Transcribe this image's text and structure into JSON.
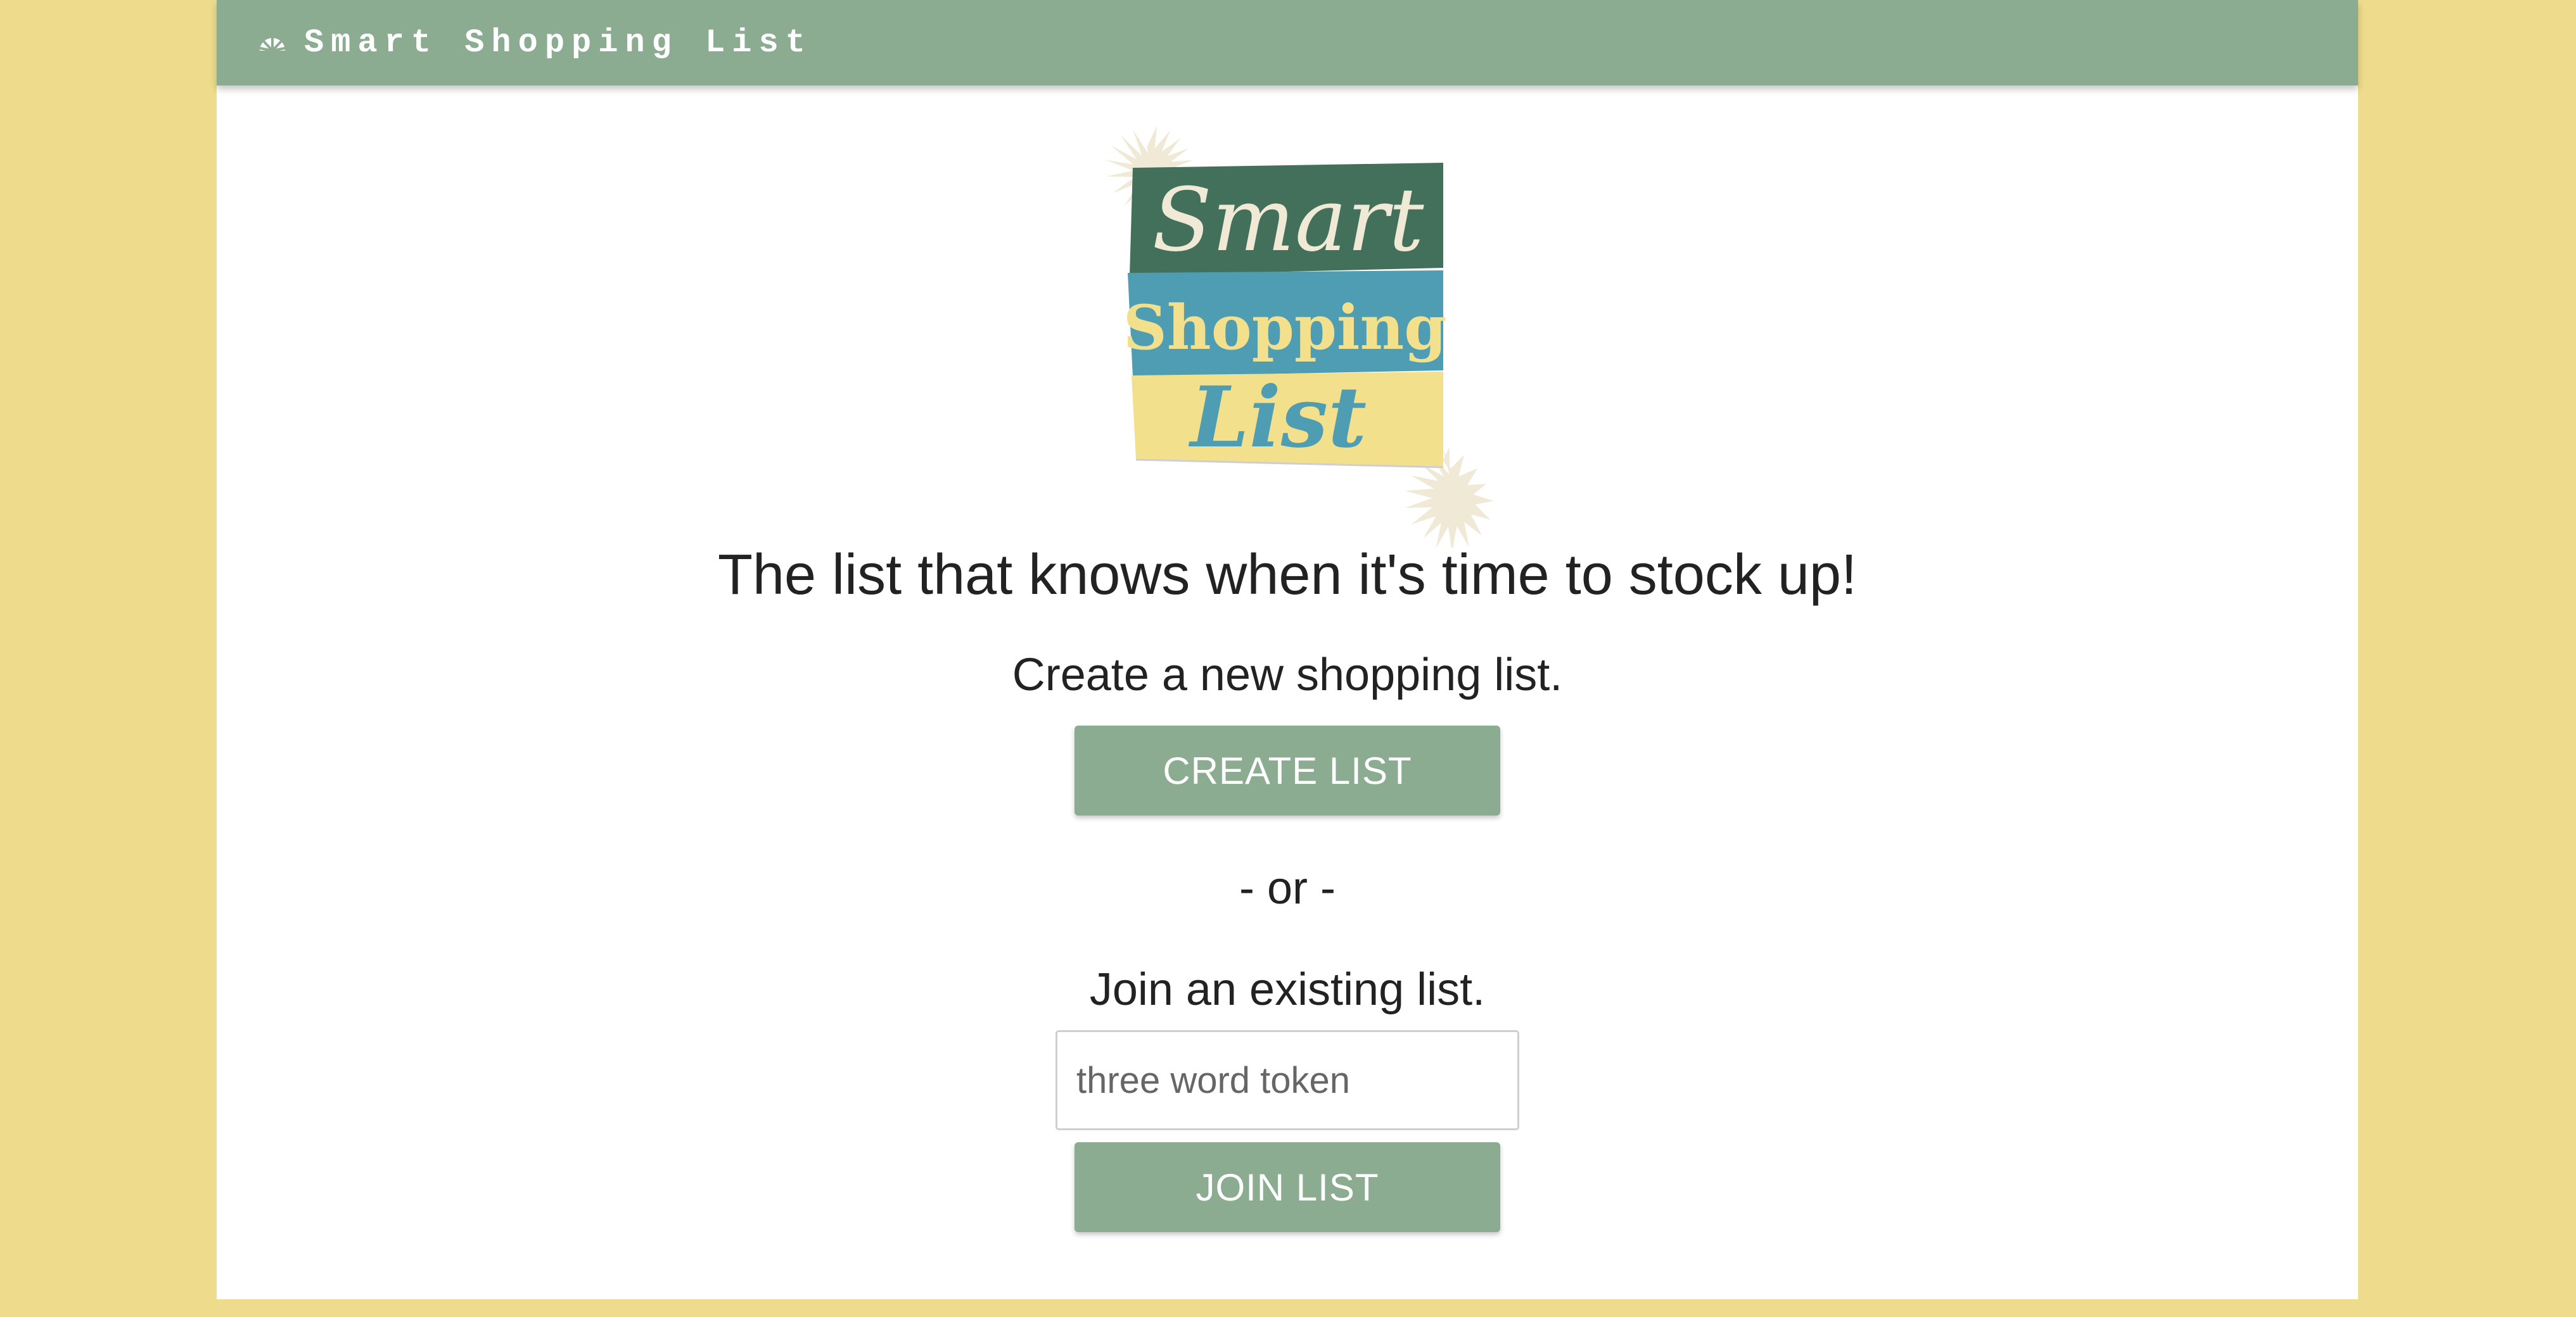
{
  "header": {
    "icon": "sunrise-icon",
    "title": "Smart Shopping List"
  },
  "logo": {
    "line1": "Smart",
    "line2": "Shopping",
    "line3": "List"
  },
  "main": {
    "tagline": "The list that knows when it's time to stock up!",
    "create_prompt": "Create a new shopping list.",
    "create_button": "CREATE LIST",
    "or_separator": "- or -",
    "join_prompt": "Join an existing list.",
    "token_placeholder": "three word token",
    "token_value": "",
    "join_button": "JOIN LIST"
  },
  "colors": {
    "page_background": "#eedc8c",
    "accent": "#8cac92",
    "logo_dark_green": "#43705a",
    "logo_teal": "#4e9db2",
    "logo_yellow": "#f3e08d",
    "logo_cream": "#efe9d6"
  }
}
